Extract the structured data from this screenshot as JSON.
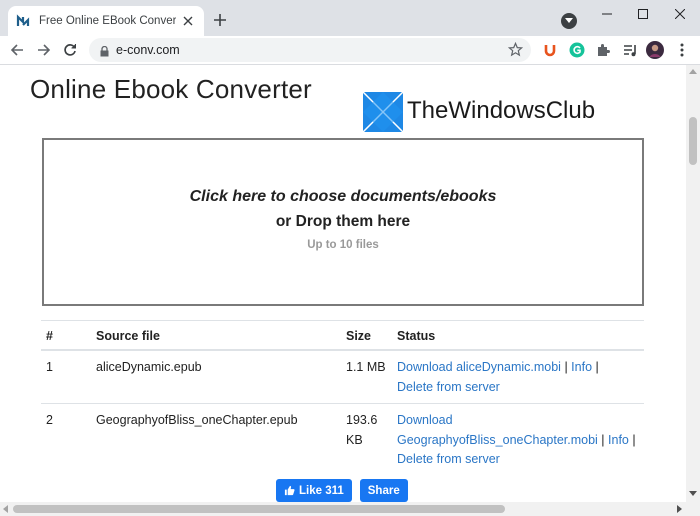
{
  "browser": {
    "tab_title": "Free Online EBook Converter (MOBI",
    "url": "e-conv.com"
  },
  "page": {
    "title": "Online Ebook Converter",
    "watermark": "TheWindowsClub"
  },
  "dropzone": {
    "line1": "Click here to choose documents/ebooks",
    "line2": "or Drop them here",
    "line3": "Up to 10 files"
  },
  "table": {
    "headers": {
      "num": "#",
      "source": "Source file",
      "size": "Size",
      "status": "Status"
    },
    "rows": [
      {
        "num": "1",
        "source": "aliceDynamic.epub",
        "size": "1.1 MB",
        "download_label": "Download aliceDynamic.mobi",
        "sep1": " | ",
        "info_label": "Info",
        "sep2": " |",
        "delete_label": "Delete from server"
      },
      {
        "num": "2",
        "source": "GeographyofBliss_oneChapter.epub",
        "size": "193.6 KB",
        "download_label": "Download GeographyofBliss_oneChapter.mobi",
        "sep1": " | ",
        "info_label": "Info",
        "sep2": " | ",
        "delete_label": "Delete from server"
      }
    ]
  },
  "social": {
    "like_label": "Like 311",
    "share_label": "Share"
  },
  "icons": {
    "favicon": "econv-favicon-icon",
    "extensions": [
      "u-extension-icon",
      "grammarly-icon",
      "puzzle-icon",
      "playlist-icon"
    ]
  },
  "colors": {
    "link": "#2a76c6",
    "facebook": "#1877f2",
    "chrome_tabstrip": "#dee1e6"
  }
}
